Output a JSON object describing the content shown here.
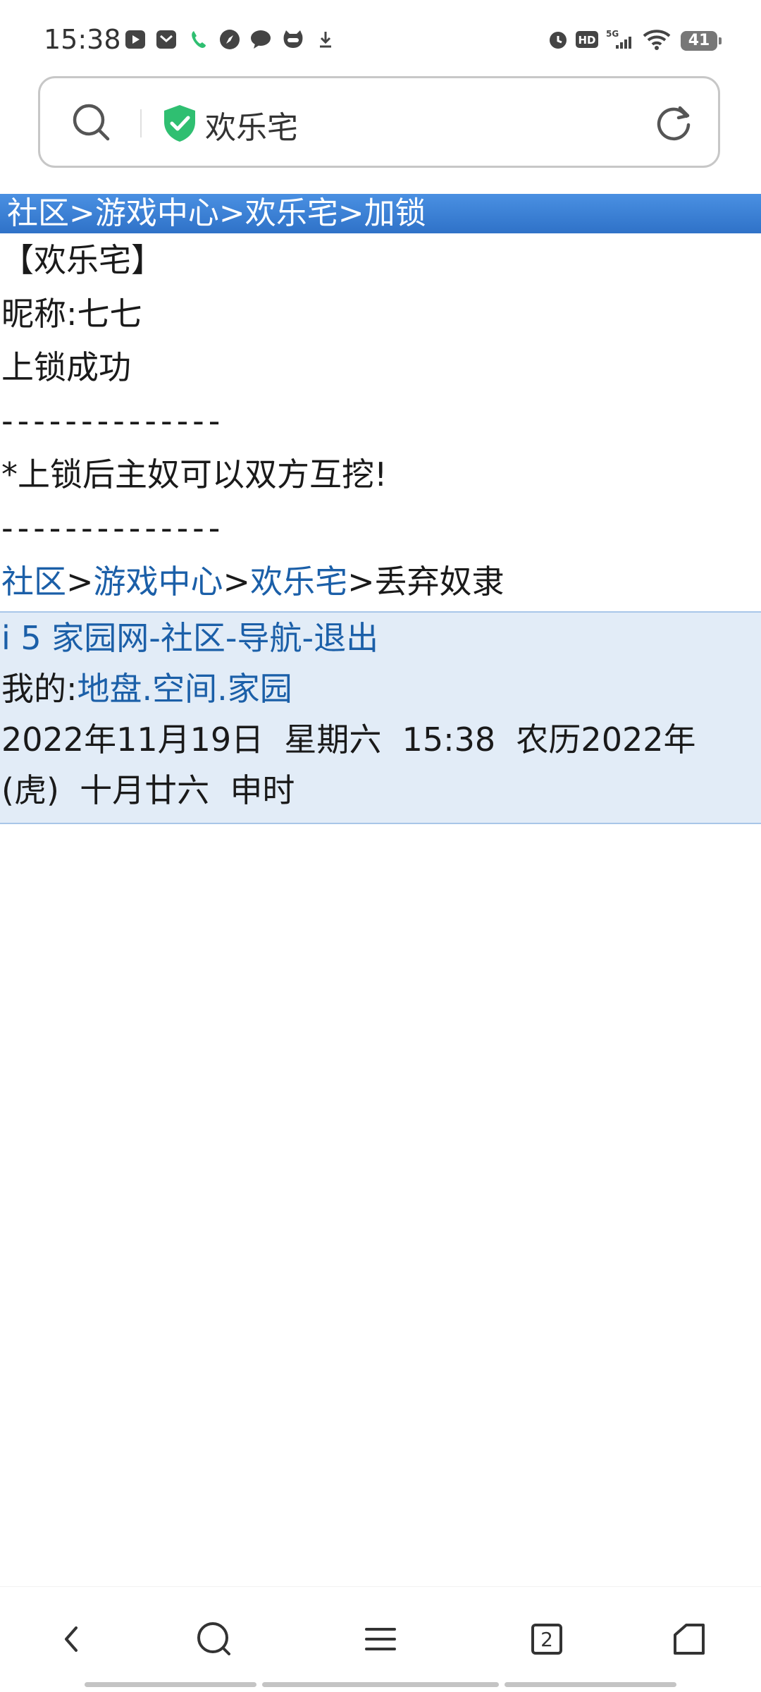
{
  "status_bar": {
    "time": "15:38",
    "battery": "41",
    "icons_left": [
      "video-app-icon",
      "mail-icon",
      "phone-icon",
      "compass-icon",
      "chat-icon",
      "cat-app-icon",
      "download-icon"
    ],
    "icons_right": [
      "alarm-icon",
      "hd-icon",
      "signal-5g-icon",
      "wifi-icon"
    ]
  },
  "address_bar": {
    "site_title": "欢乐宅",
    "secure_color": "#2fbf71"
  },
  "page": {
    "breadcrumb_top": "社区>游戏中心>欢乐宅>加锁",
    "title": "【欢乐宅】",
    "nickname": "昵称:七七",
    "message": "上锁成功",
    "separator_1": "--------------",
    "note": "*上锁后主奴可以双方互挖!",
    "separator_2": "--------------",
    "breadcrumb_bottom": {
      "links": [
        "社区",
        "游戏中心",
        "欢乐宅"
      ],
      "sep": ">",
      "current": "丢弃奴隶"
    },
    "footer": {
      "site_links": [
        "i 5 家园网",
        "社区",
        "导航",
        "退出"
      ],
      "dash": "-",
      "my_label": "我的:",
      "my_links": [
        "地盘",
        "空间",
        "家园"
      ],
      "dot": ".",
      "datetime_line1": "2022年11月19日  星期六  15:38  农历2022年",
      "datetime_line2": "(虎)  十月廿六  申时"
    }
  },
  "bottom_nav": {
    "tab_count": "2",
    "items": [
      "back-icon",
      "search-icon",
      "menu-icon",
      "tabs-icon",
      "home-icon"
    ]
  },
  "colors": {
    "link": "#1b5fa8",
    "header_bar": "#3a7fd6",
    "footer_bg": "#e2ecf7"
  }
}
